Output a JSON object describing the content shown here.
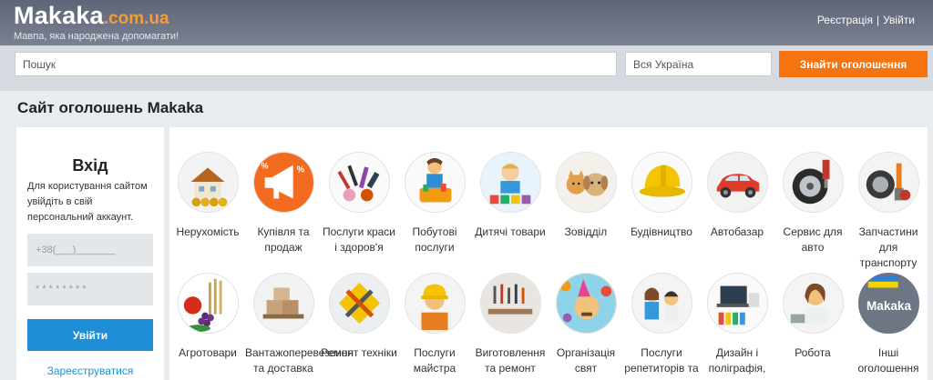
{
  "header": {
    "logo": "Makaka",
    "logo_domain": ".com.ua",
    "tagline": "Мавпа, яка народжена допомагати!",
    "register_link": "Реєстрація",
    "separator": "|",
    "login_link": "Увійти"
  },
  "search": {
    "query_placeholder": "Пошук",
    "region_value": "Вся Україна",
    "button_label": "Знайти оголошення"
  },
  "page": {
    "title": "Сайт оголошень Makaka"
  },
  "login": {
    "title": "Вхід",
    "description": "Для користування сайтом увійдіть в свій персональний аккаунт.",
    "phone_placeholder": "+38(___)_______",
    "password_placeholder": "* * * * * * * *",
    "submit_label": "Увійти",
    "register_label": "Зареєструватися"
  },
  "categories": [
    {
      "label": "Нерухомість",
      "icon": "house-icon"
    },
    {
      "label": "Купівля та продаж",
      "icon": "megaphone-icon"
    },
    {
      "label": "Послуги краси і здоров'я",
      "icon": "cosmetics-icon"
    },
    {
      "label": "Побутові послуги",
      "icon": "cleaning-icon"
    },
    {
      "label": "Дитячі товари",
      "icon": "kids-toys-icon"
    },
    {
      "label": "Зовідділ",
      "icon": "pets-icon"
    },
    {
      "label": "Будівництво",
      "icon": "hard-hat-icon"
    },
    {
      "label": "Автобазар",
      "icon": "car-icon"
    },
    {
      "label": "Сервис для авто",
      "icon": "tire-service-icon"
    },
    {
      "label": "Запчастини для транспорту",
      "icon": "car-parts-icon"
    },
    {
      "label": "Агротовари",
      "icon": "agro-icon"
    },
    {
      "label": "Вантажоперевезення та доставка",
      "icon": "boxes-icon"
    },
    {
      "label": "Ремонт техніки",
      "icon": "tools-icon"
    },
    {
      "label": "Послуги майстра",
      "icon": "handyman-icon"
    },
    {
      "label": "Виготовлення та ремонт",
      "icon": "workshop-icon"
    },
    {
      "label": "Організація свят",
      "icon": "party-icon"
    },
    {
      "label": "Послуги репетиторів та",
      "icon": "tutor-icon"
    },
    {
      "label": "Дизайн і поліграфія,",
      "icon": "design-icon"
    },
    {
      "label": "Робота",
      "icon": "job-icon"
    },
    {
      "label": "Інші оголошення",
      "icon": "makaka-flag-icon"
    }
  ]
}
